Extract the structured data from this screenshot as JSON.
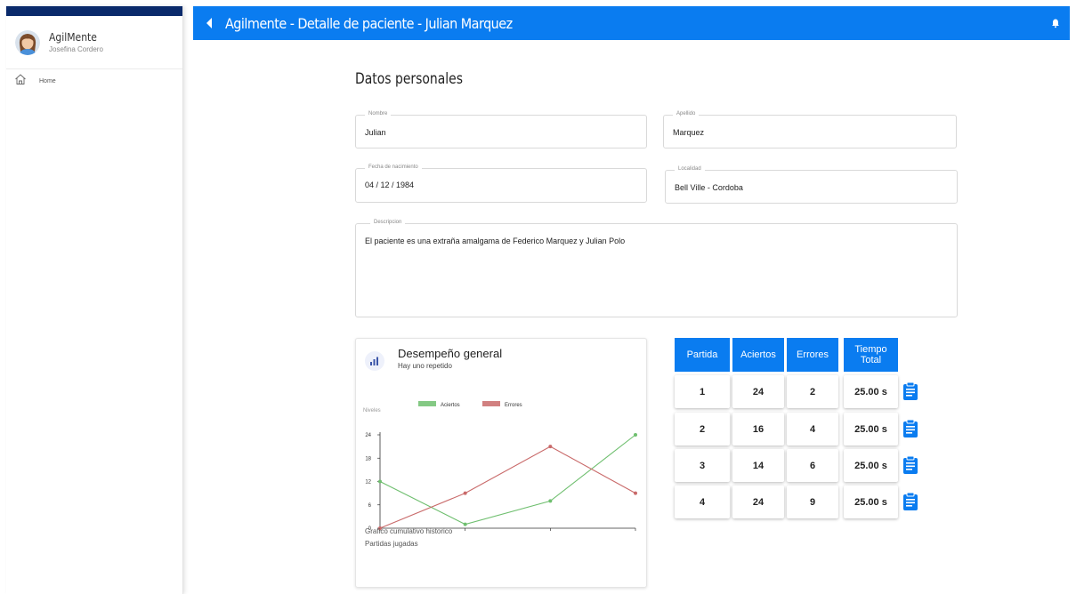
{
  "sidebar": {
    "app_name": "AgilMente",
    "user_name": "Josefina Cordero",
    "nav": [
      {
        "label": "Home",
        "icon": "home-icon"
      }
    ]
  },
  "header": {
    "title": "Agilmente - Detalle de paciente - Julian Marquez",
    "color": "#0a7cf0"
  },
  "personal": {
    "section_title": "Datos personales",
    "nombre_label": "Nombre",
    "nombre": "Julian",
    "apellido_label": "Apellido",
    "apellido": "Marquez",
    "fecha_label": "Fecha de nacimiento",
    "fecha": "04 / 12 / 1984",
    "localidad_label": "Localidad",
    "localidad": "Bell Ville - Cordoba",
    "descripcion_label": "Descripcion",
    "descripcion": "El paciente es una extraña amalgama de Federico Marquez y Julian Polo"
  },
  "performance": {
    "title": "Desempeño general",
    "subtitle": "Hay uno repetido",
    "caption_1": "Grafico cumulativo historico",
    "caption_2": "Partidas jugadas"
  },
  "chart_data": {
    "type": "line",
    "x": [
      0,
      1,
      2,
      3
    ],
    "series": [
      {
        "name": "Aciertos",
        "values": [
          12,
          1,
          7,
          24
        ],
        "color": "#6fbf6f"
      },
      {
        "name": "Errores",
        "values": [
          0,
          9,
          21,
          9
        ],
        "color": "#c96a6a"
      }
    ],
    "xlabel": "Partidas",
    "ylabel": "Niveles",
    "yticks": [
      0,
      6,
      12,
      18,
      24
    ],
    "xticks": [
      0,
      1,
      2,
      3
    ],
    "ylim": [
      0,
      24
    ],
    "xlim": [
      0,
      3
    ],
    "legend": "top"
  },
  "games_table": {
    "headers": [
      "Partida",
      "Aciertos",
      "Errores",
      "Tiempo Total"
    ],
    "rows": [
      [
        "1",
        "24",
        "2",
        "25.00 s"
      ],
      [
        "2",
        "16",
        "4",
        "25.00 s"
      ],
      [
        "3",
        "14",
        "6",
        "25.00 s"
      ],
      [
        "4",
        "24",
        "9",
        "25.00 s"
      ]
    ],
    "row_icon": "clipboard-icon"
  }
}
